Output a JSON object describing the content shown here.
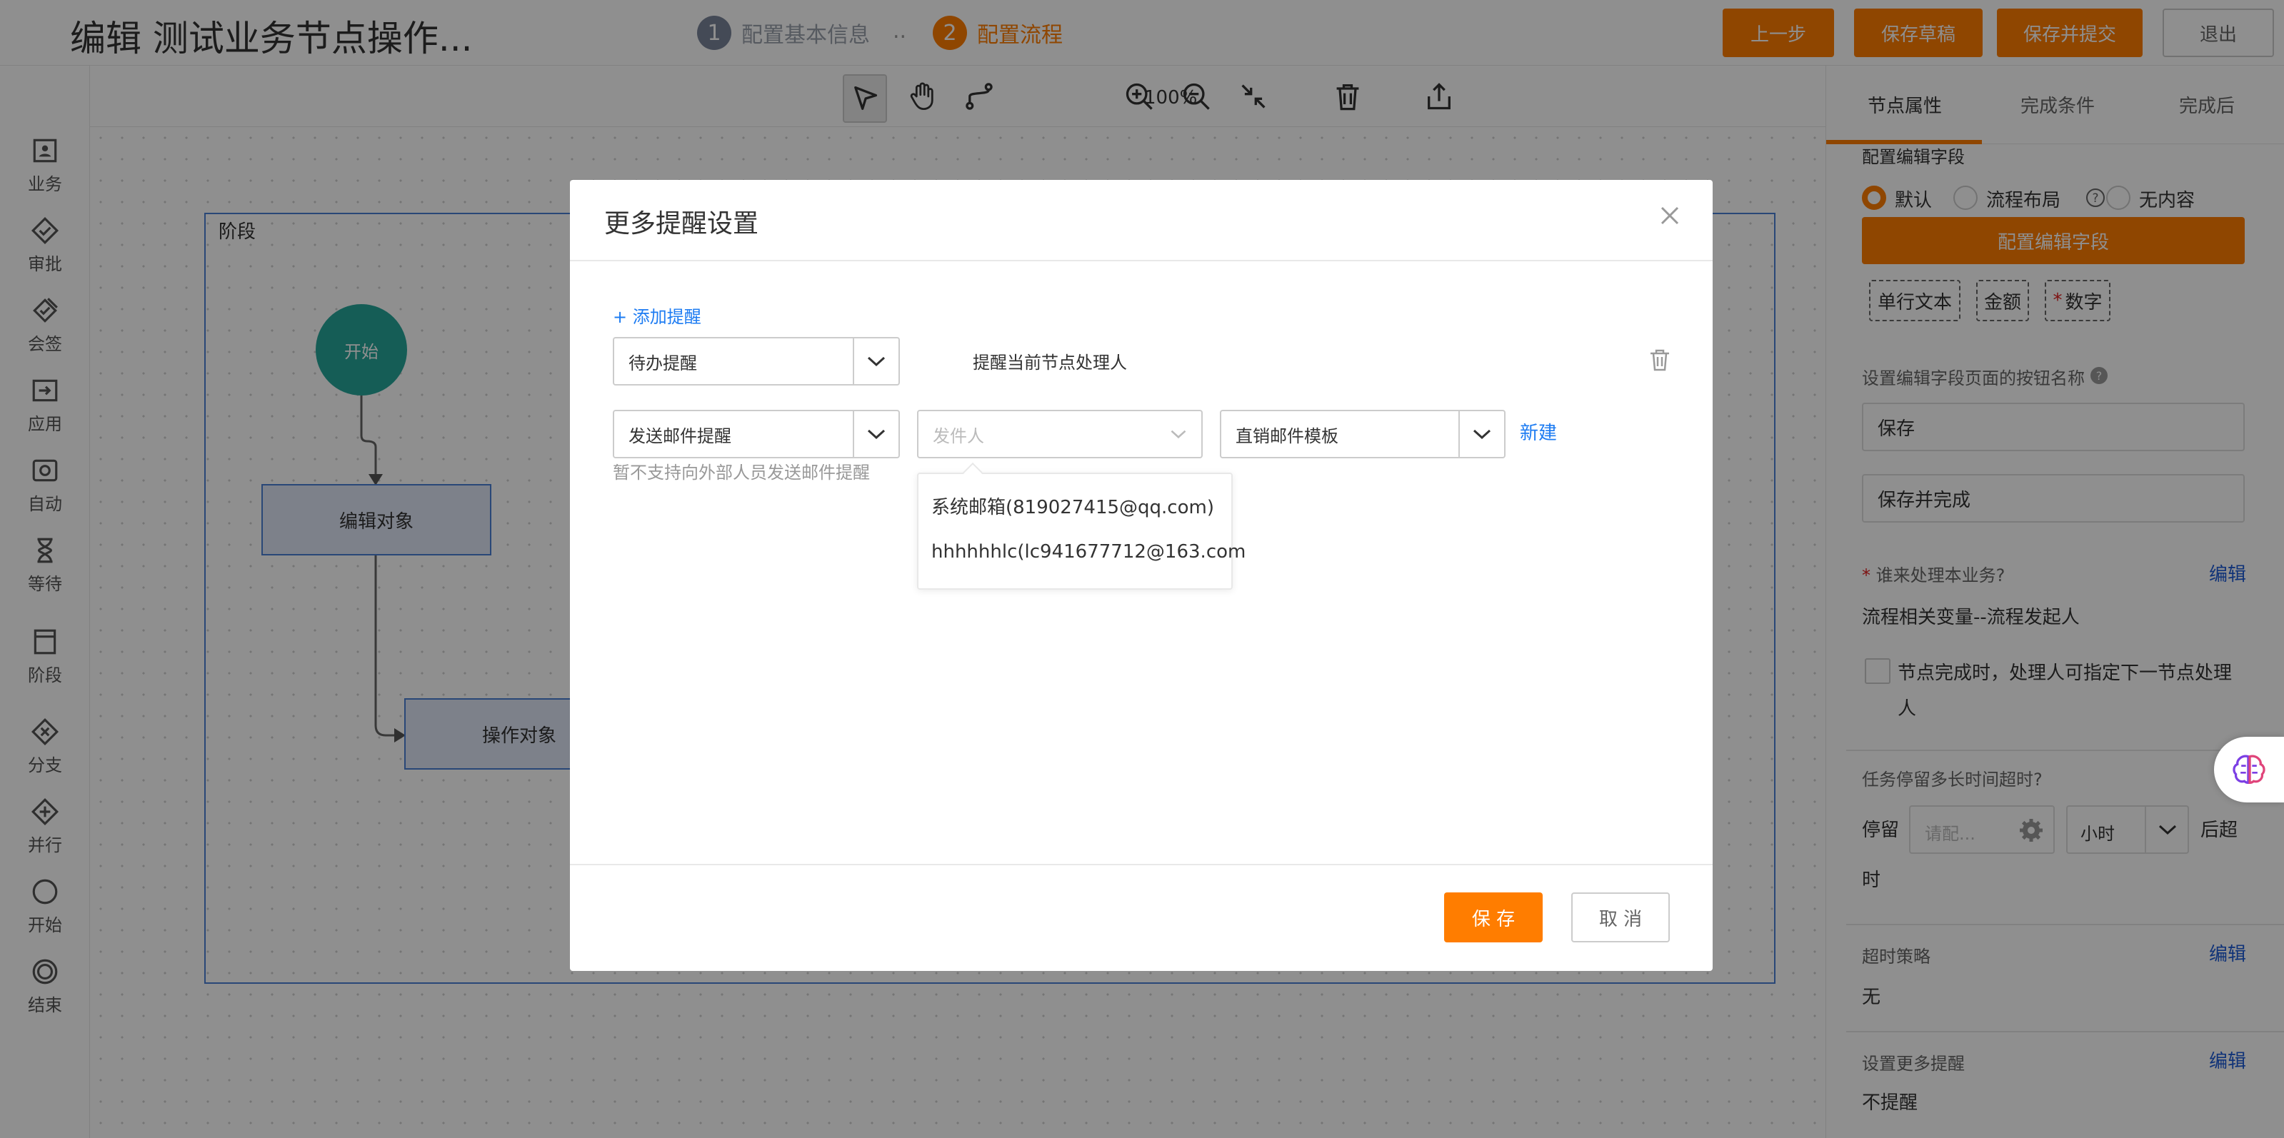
{
  "header": {
    "title": "编辑 测试业务节点操作...",
    "steps": [
      {
        "num": "1",
        "label": "配置基本信息"
      },
      {
        "num": "2",
        "label": "配置流程"
      }
    ],
    "step_separator": "..",
    "buttons": {
      "prev": "上一步",
      "save_draft": "保存草稿",
      "save_submit": "保存并提交",
      "exit": "退出"
    }
  },
  "sidebar": {
    "items": [
      {
        "label": "业务",
        "icon": "business-icon"
      },
      {
        "label": "审批",
        "icon": "approve-icon"
      },
      {
        "label": "会签",
        "icon": "countersign-icon"
      },
      {
        "label": "应用",
        "icon": "app-icon"
      },
      {
        "label": "自动",
        "icon": "auto-icon"
      },
      {
        "label": "等待",
        "icon": "hourglass-icon"
      },
      {
        "label": "阶段",
        "icon": "stage-icon"
      },
      {
        "label": "分支",
        "icon": "branch-icon"
      },
      {
        "label": "并行",
        "icon": "parallel-icon"
      },
      {
        "label": "开始",
        "icon": "start-icon"
      },
      {
        "label": "结束",
        "icon": "end-icon"
      }
    ]
  },
  "toolbar": {
    "zoom": "100%"
  },
  "canvas": {
    "stage_label": "阶段",
    "nodes": {
      "start": "开始",
      "edit": "编辑对象",
      "operate": "操作对象"
    }
  },
  "right_panel": {
    "tabs": [
      "节点属性",
      "完成条件",
      "完成后"
    ],
    "edit_fields_label": "配置编辑字段",
    "radios": [
      "默认",
      "流程布局",
      "无内容"
    ],
    "config_button": "配置编辑字段",
    "field_tags": [
      "单行文本",
      "金额",
      "数字"
    ],
    "button_name_label": "设置编辑字段页面的按钮名称",
    "save_value": "保存",
    "save_complete_value": "保存并完成",
    "handler_label": "谁来处理本业务?",
    "edit_link": "编辑",
    "handler_value": "流程相关变量--流程发起人",
    "checkbox_label_1": "节点完成时，处理人可指定下一节点处理",
    "checkbox_label_2": "人",
    "timeout_label": "任务停留多长时间超时?",
    "stay_label": "停留",
    "stay_placeholder": "请配...",
    "unit": "小时",
    "after_label": "后超",
    "after_label_2": "时",
    "strategy_label": "超时策略",
    "strategy_value": "无",
    "more_reminder_label": "设置更多提醒",
    "more_reminder_value": "不提醒"
  },
  "modal": {
    "title": "更多提醒设置",
    "close": "×",
    "add_link": "+ 添加提醒",
    "reminder_type": "待办提醒",
    "reminder_target": "提醒当前节点处理人",
    "send_type": "发送邮件提醒",
    "sender_placeholder": "发件人",
    "template": "直销邮件模板",
    "new_link": "新建",
    "note": "暂不支持向外部人员发送邮件提醒",
    "dropdown_items": [
      "系统邮箱(819027415@qq.com)",
      "hhhhhhlc(lc941677712@163.com"
    ],
    "save": "保 存",
    "cancel": "取 消"
  },
  "colors": {
    "accent": "#ff7d00",
    "link": "#1e7cf2",
    "start_node": "#26a69a",
    "stage_border": "#4a7fd4"
  }
}
